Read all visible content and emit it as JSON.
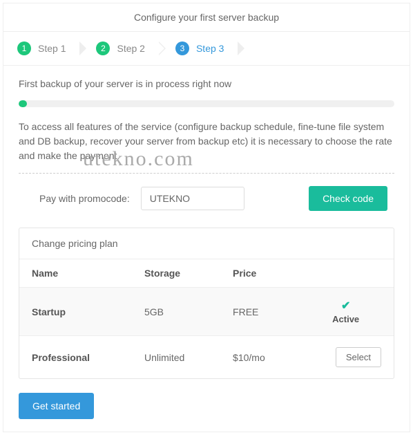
{
  "header": {
    "title": "Configure your first server backup"
  },
  "steps": [
    {
      "num": "1",
      "label": "Step 1",
      "color": "green",
      "active": false
    },
    {
      "num": "2",
      "label": "Step 2",
      "color": "green",
      "active": false
    },
    {
      "num": "3",
      "label": "Step 3",
      "color": "blue",
      "active": true
    }
  ],
  "status": "First backup of your server is in process right now",
  "info": "To access all features of the service (configure backup schedule, fine-tune file system and DB backup, recover your server from backup etc) it is necessary to choose the rate and make the payment.",
  "promo": {
    "label": "Pay with promocode:",
    "value": "UTEKNO",
    "check_label": "Check code"
  },
  "plan": {
    "title": "Change pricing plan",
    "headers": {
      "name": "Name",
      "storage": "Storage",
      "price": "Price"
    },
    "rows": [
      {
        "name": "Startup",
        "storage": "5GB",
        "price": "FREE",
        "active": true,
        "active_label": "Active"
      },
      {
        "name": "Professional",
        "storage": "Unlimited",
        "price": "$10/mo",
        "active": false,
        "select_label": "Select"
      }
    ]
  },
  "cta": {
    "get_started": "Get started"
  },
  "watermark": "utekno.com"
}
